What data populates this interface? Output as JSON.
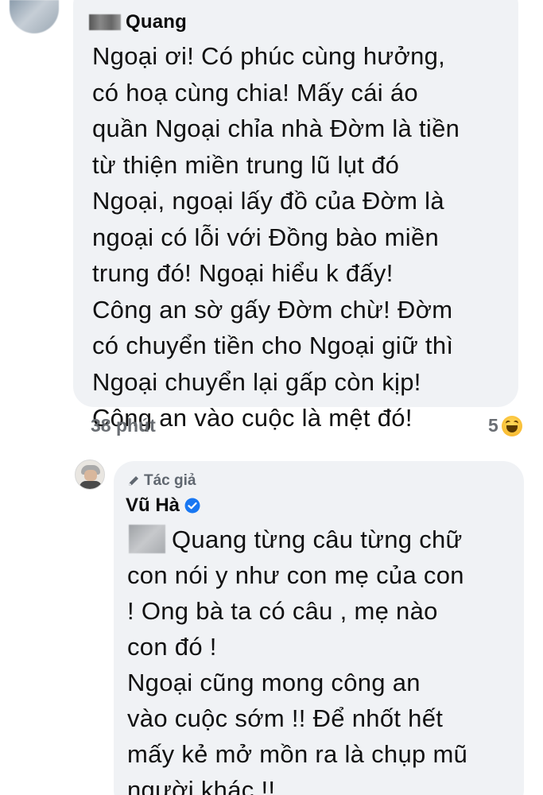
{
  "comment1": {
    "author": "Quang",
    "lines": [
      "Ngoại ơi! Có phúc cùng hưởng,",
      "có hoạ cùng chia! Mấy cái áo",
      "quần Ngoại chỉa nhà Đờm là tiền",
      "từ thiện miền trung lũ lụt đó",
      "Ngoại, ngoại lấy đồ của Đờm là",
      "ngoại có lỗi với Đồng bào miền",
      "trung đó! Ngoại hiểu k đấy!",
      "Công an sờ gấy Đờm chừ! Đờm",
      "có chuyển tiền cho Ngoại giữ thì",
      "Ngoại chuyển lại gấp còn kịp!",
      "Công an vào cuộc là mệt đó!"
    ],
    "time": "38 phút",
    "reaction_count": "5",
    "reaction_icon": "haha-emoji-icon"
  },
  "reply": {
    "author_badge": "Tác giả",
    "author": "Vũ Hà",
    "verified": true,
    "lines": [
      "Quang từng câu từng chữ",
      "con nói y như con mẹ của con",
      "! Ong bà ta có câu , mẹ nào",
      "con đó !",
      "Ngoại cũng mong công an",
      "vào cuộc sớm !! Để nhốt hết",
      "mấy kẻ mở mồn ra là chụp mũ",
      "người khác !!"
    ]
  },
  "colors": {
    "bubble": "#f0f2f5",
    "meta_text": "#6a6e73",
    "verified_blue": "#1877f2",
    "haha_yellow": "#f7b125"
  }
}
